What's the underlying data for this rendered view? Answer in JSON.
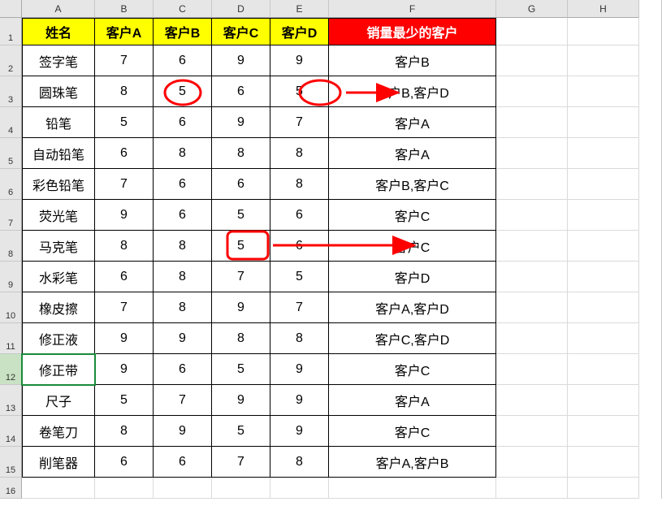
{
  "columns": [
    "A",
    "B",
    "C",
    "D",
    "E",
    "F",
    "G",
    "H"
  ],
  "row_numbers": [
    1,
    2,
    3,
    4,
    5,
    6,
    7,
    8,
    9,
    10,
    11,
    12,
    13,
    14,
    15,
    16
  ],
  "headers": {
    "name": "姓名",
    "a": "客户A",
    "b": "客户B",
    "c": "客户C",
    "d": "客户D",
    "min": "销量最少的客户"
  },
  "rows": [
    {
      "name": "签字笔",
      "a": "7",
      "b": "6",
      "c": "9",
      "d": "9",
      "min": "客户B"
    },
    {
      "name": "圆珠笔",
      "a": "8",
      "b": "5",
      "c": "6",
      "d": "5",
      "min": "客户B,客户D"
    },
    {
      "name": "铅笔",
      "a": "5",
      "b": "6",
      "c": "9",
      "d": "7",
      "min": "客户A"
    },
    {
      "name": "自动铅笔",
      "a": "6",
      "b": "8",
      "c": "8",
      "d": "8",
      "min": "客户A"
    },
    {
      "name": "彩色铅笔",
      "a": "7",
      "b": "6",
      "c": "6",
      "d": "8",
      "min": "客户B,客户C"
    },
    {
      "name": "荧光笔",
      "a": "9",
      "b": "6",
      "c": "5",
      "d": "6",
      "min": "客户C"
    },
    {
      "name": "马克笔",
      "a": "8",
      "b": "8",
      "c": "5",
      "d": "6",
      "min": "客户C"
    },
    {
      "name": "水彩笔",
      "a": "6",
      "b": "8",
      "c": "7",
      "d": "5",
      "min": "客户D"
    },
    {
      "name": "橡皮擦",
      "a": "7",
      "b": "8",
      "c": "9",
      "d": "7",
      "min": "客户A,客户D"
    },
    {
      "name": "修正液",
      "a": "9",
      "b": "9",
      "c": "8",
      "d": "8",
      "min": "客户C,客户D"
    },
    {
      "name": "修正带",
      "a": "9",
      "b": "6",
      "c": "5",
      "d": "9",
      "min": "客户C"
    },
    {
      "name": "尺子",
      "a": "5",
      "b": "7",
      "c": "9",
      "d": "9",
      "min": "客户A"
    },
    {
      "name": "卷笔刀",
      "a": "8",
      "b": "9",
      "c": "5",
      "d": "9",
      "min": "客户C"
    },
    {
      "name": "削笔器",
      "a": "6",
      "b": "6",
      "c": "7",
      "d": "8",
      "min": "客户A,客户B"
    }
  ],
  "active_cell": "A12"
}
